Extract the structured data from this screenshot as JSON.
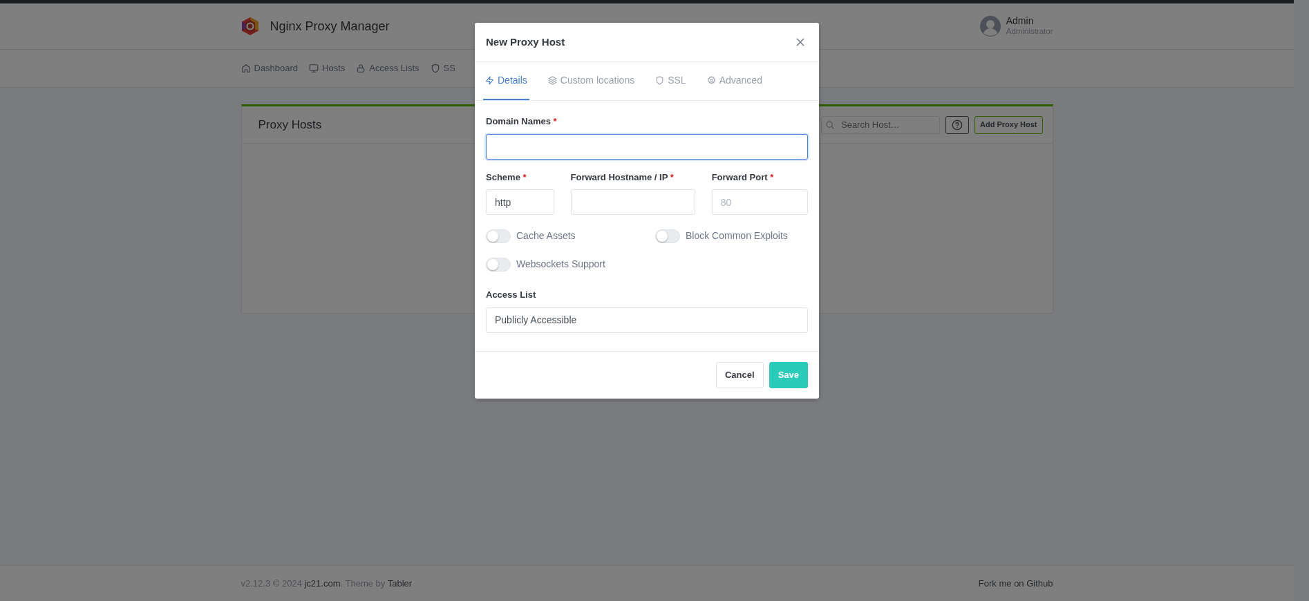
{
  "header": {
    "app_title": "Nginx Proxy Manager",
    "user": {
      "name": "Admin",
      "role": "Administrator"
    }
  },
  "nav": [
    {
      "label": "Dashboard"
    },
    {
      "label": "Hosts"
    },
    {
      "label": "Access Lists"
    },
    {
      "label": "SS"
    }
  ],
  "card": {
    "title": "Proxy Hosts",
    "search": {
      "placeholder": "Search Host…"
    },
    "add_button": "Add Proxy Host"
  },
  "modal": {
    "title": "New Proxy Host",
    "tabs": [
      {
        "label": "Details",
        "selected": true
      },
      {
        "label": "Custom locations",
        "selected": false
      },
      {
        "label": "SSL",
        "selected": false
      },
      {
        "label": "Advanced",
        "selected": false
      }
    ],
    "domain_names": {
      "label": "Domain Names",
      "required_mark": "*",
      "focused": true
    },
    "fields": [
      {
        "label": "Scheme",
        "required_mark": "*",
        "value": "http"
      },
      {
        "label": "Forward Hostname / IP",
        "required_mark": "*"
      },
      {
        "label": "Forward Port",
        "required_mark": "*",
        "placeholder": "80"
      }
    ],
    "toggles": [
      {
        "label": "Cache Assets",
        "on": false
      },
      {
        "label": "Block Common Exploits",
        "on": false
      },
      {
        "label": "Websockets Support",
        "on": false
      }
    ],
    "access_list": {
      "label": "Access List",
      "value": "Publicly Accessible"
    },
    "buttons": {
      "cancel": "Cancel",
      "save": "Save"
    }
  },
  "footer": {
    "parts": [
      {
        "kind": "text",
        "text": "v2.12.3 © 2024 "
      },
      {
        "kind": "link",
        "text": "jc21.com"
      },
      {
        "kind": "text",
        "text": ". Theme by "
      },
      {
        "kind": "link",
        "text": "Tabler"
      }
    ],
    "github_link": "Fork me on Github"
  }
}
